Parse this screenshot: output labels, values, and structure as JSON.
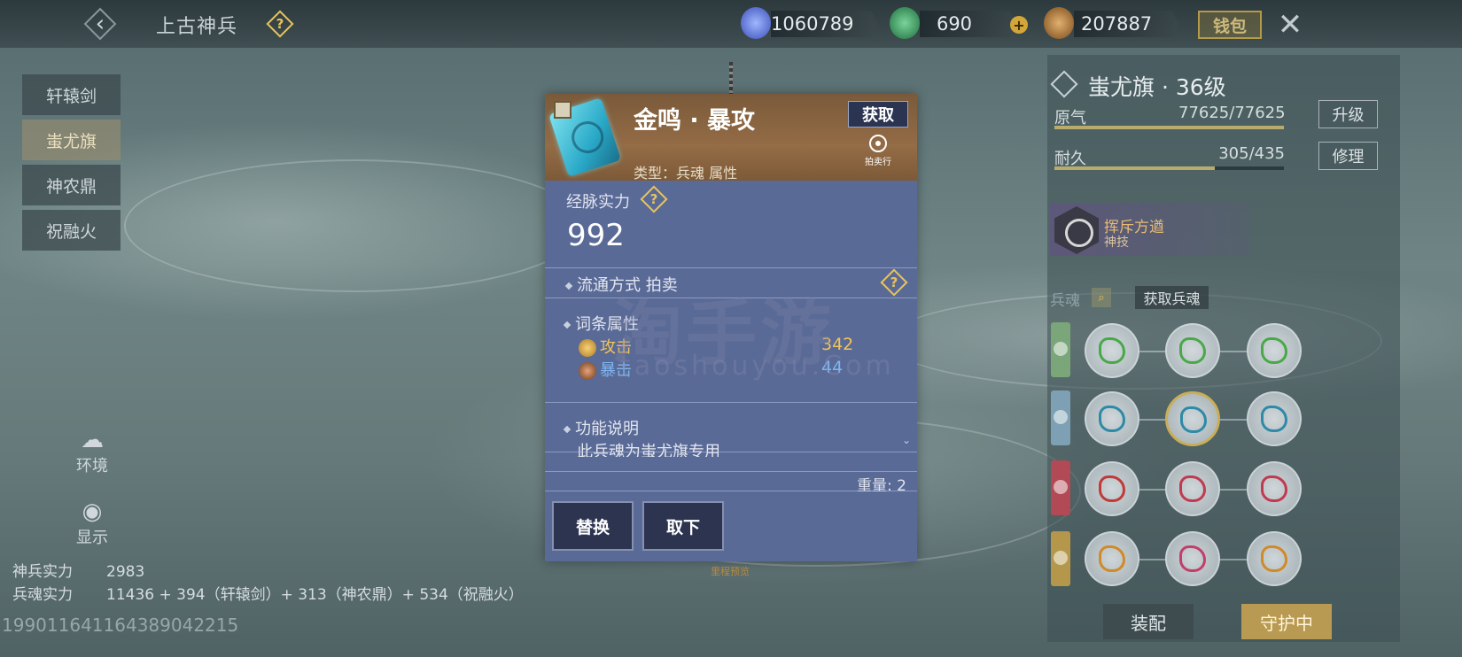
{
  "header": {
    "title": "上古神兵",
    "help": "?",
    "currencies": [
      {
        "icon": "blue-crystal-icon",
        "value": "1060789"
      },
      {
        "icon": "green-jade-icon",
        "value": "690"
      },
      {
        "icon": "bronze-coin-icon",
        "value": "207887"
      }
    ],
    "plus": "+",
    "wallet_label": "钱包",
    "close": "✕"
  },
  "sidebar": {
    "tabs": [
      {
        "label": "轩辕剑",
        "active": false
      },
      {
        "label": "蚩尤旗",
        "active": true
      },
      {
        "label": "神农鼎",
        "active": false
      },
      {
        "label": "祝融火",
        "active": false
      }
    ],
    "tools": [
      {
        "icon": "environment-icon",
        "label": "环境"
      },
      {
        "icon": "eye-icon",
        "label": "显示"
      }
    ]
  },
  "stats": {
    "weapon_power_label": "神兵实力",
    "weapon_power_value": "2983",
    "soul_power_label": "兵魂实力",
    "soul_power_value": "11436 + 394（轩辕剑）+ 313（神农鼎）+ 534（祝融火）"
  },
  "uid": "1990116411643890422​15",
  "card": {
    "name": "金鸣 · 暴攻",
    "acquire_label": "获取",
    "auction_icon_caption": "拍卖行",
    "type_text": "类型：兵魂 属性",
    "power_label": "经脉实力",
    "power_value": "992",
    "circulation_text": "流通方式    拍卖",
    "attr_section_label": "词条属性",
    "attributes": [
      {
        "icon": "attack-icon",
        "name": "攻击",
        "value": "342",
        "color": "#f2c35a"
      },
      {
        "icon": "crit-icon",
        "name": "暴击",
        "value": "44",
        "color": "#7fb6f2"
      }
    ],
    "func_label": "功能说明",
    "func_text": "此兵魂为蚩尤旗专用",
    "weight_text": "重量: 2",
    "replace_label": "替换",
    "remove_label": "取下",
    "footer_text": "里程预览"
  },
  "watermark": {
    "main": "淘手游",
    "sub": "taoshouyou.Com"
  },
  "right": {
    "title": "蚩尤旗 · 36级",
    "bars": [
      {
        "label": "原气",
        "value": "77625/77625",
        "fraction": 1.0,
        "button": "升级"
      },
      {
        "label": "耐久",
        "value": "305/435",
        "fraction": 0.7,
        "button": "修理"
      }
    ],
    "skill_name": "挥斥方遒",
    "skill_sub": "神技",
    "soul_label": "兵魂",
    "get_soul_label": "获取兵魂",
    "row_colors": [
      "#7aa67a",
      "#7da0b4",
      "#b24a55",
      "#b4974a"
    ],
    "slot_colors": [
      [
        "#4aa84a",
        "#4aa84a",
        "#4aa84a"
      ],
      [
        "#2e8aa6",
        "#2e8aa6",
        "#2e8aa6"
      ],
      [
        "#c03a3a",
        "#c03a50",
        "#c03a50"
      ],
      [
        "#d08a2a",
        "#c0406a",
        "#d08a2a"
      ]
    ],
    "equip_label": "装配",
    "guard_label": "守护中"
  }
}
